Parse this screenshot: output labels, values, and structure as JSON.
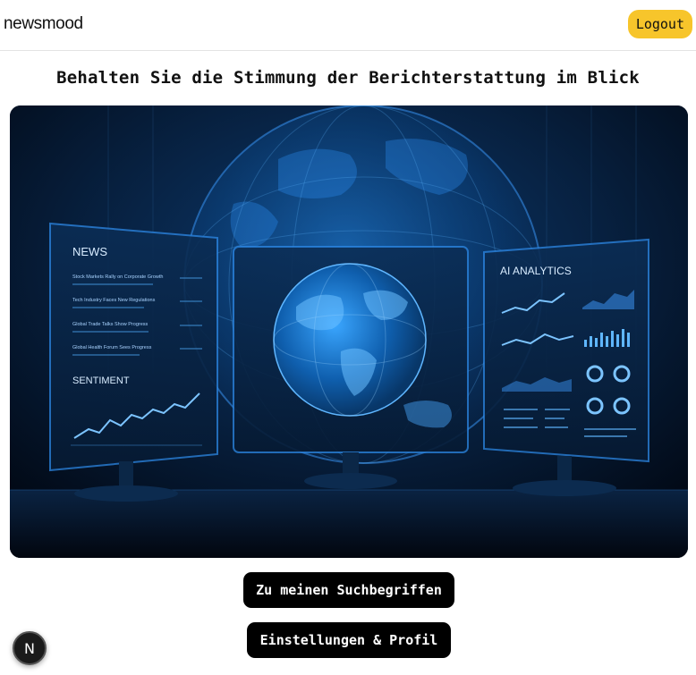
{
  "header": {
    "brand": "newsmood",
    "logout_label": "Logout"
  },
  "main": {
    "headline": "Behalten Sie die Stimmung der Berichterstattung im Blick",
    "hero": {
      "left_panel_title": "NEWS",
      "left_panel_items": [
        "Stock Markets Rally on Corporate Growth",
        "Tech Industry Faces New Regulations",
        "Global Trade Talks Show Progress",
        "Global Health Forum Sees Progress"
      ],
      "left_panel_section": "SENTIMENT",
      "right_panel_title": "AI ANALYTICS"
    },
    "buttons": {
      "keywords_label": "Zu meinen Suchbegriffen",
      "settings_label": "Einstellungen & Profil"
    }
  },
  "dev_badge": {
    "letter": "N",
    "icon": "nextjs-logo-icon"
  },
  "colors": {
    "accent": "#f7c52b",
    "button_bg": "#000000",
    "hero_bg": "#041226",
    "hero_glow": "#2f9dff"
  }
}
